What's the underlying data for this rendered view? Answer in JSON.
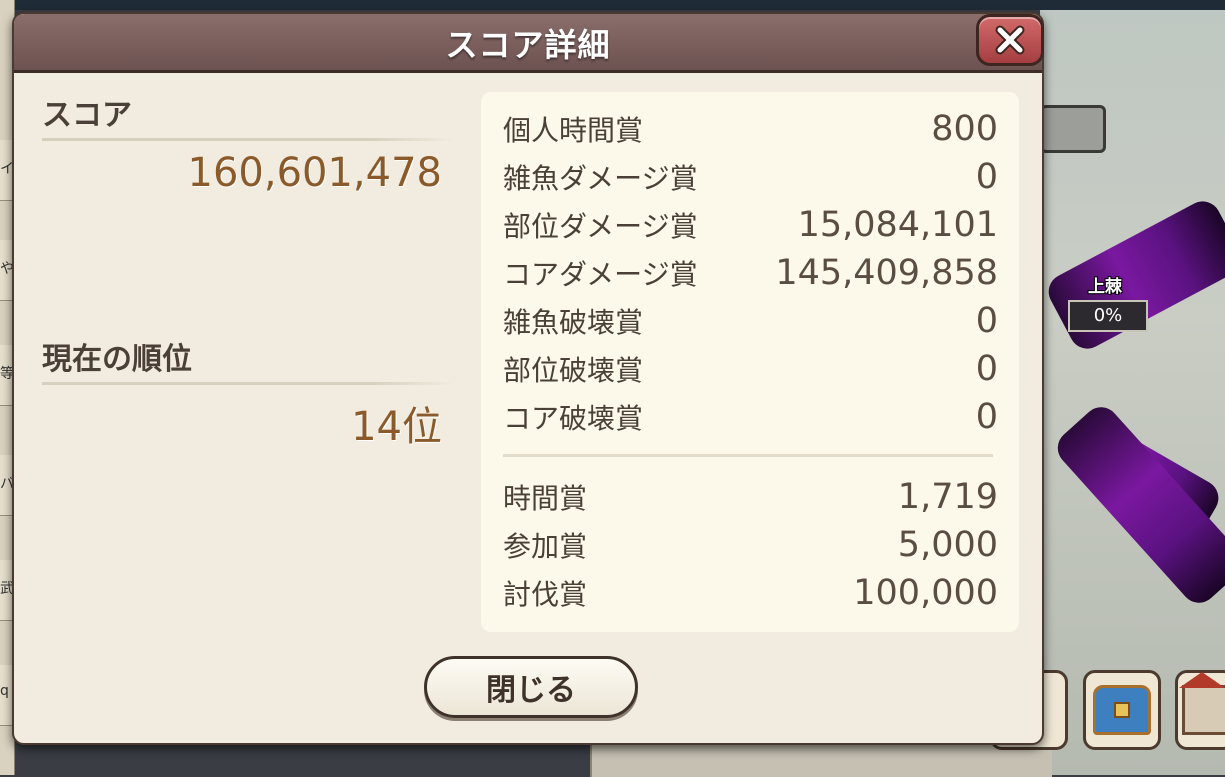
{
  "dialog": {
    "title": "スコア詳細",
    "close_bottom_label": "閉じる"
  },
  "summary": {
    "score_label": "スコア",
    "score_value": "160,601,478",
    "rank_label": "現在の順位",
    "rank_value": "14位"
  },
  "breakdown": {
    "items": [
      {
        "label": "個人時間賞",
        "value": "800"
      },
      {
        "label": "雑魚ダメージ賞",
        "value": "0"
      },
      {
        "label": "部位ダメージ賞",
        "value": "15,084,101"
      },
      {
        "label": "コアダメージ賞",
        "value": "145,409,858"
      },
      {
        "label": "雑魚破壊賞",
        "value": "0"
      },
      {
        "label": "部位破壊賞",
        "value": "0"
      },
      {
        "label": "コア破壊賞",
        "value": "0"
      }
    ],
    "bonus_items": [
      {
        "label": "時間賞",
        "value": "1,719"
      },
      {
        "label": "参加賞",
        "value": "5,000"
      },
      {
        "label": "討伐賞",
        "value": "100,000"
      }
    ]
  },
  "background": {
    "gauge_label": "上棘",
    "gauge_value": "0%",
    "left_tab_chars": [
      "イ",
      "や",
      "等",
      "バ",
      "武",
      "q"
    ]
  },
  "colors": {
    "header": "#7a5f5d",
    "close_button": "#b84a4c",
    "value_text": "#8a5a2a",
    "panel_bg": "#fcf8ea"
  },
  "icons": {
    "close": "close-x-icon",
    "chest": "treasure-chest-icon",
    "house": "shop-house-icon"
  }
}
